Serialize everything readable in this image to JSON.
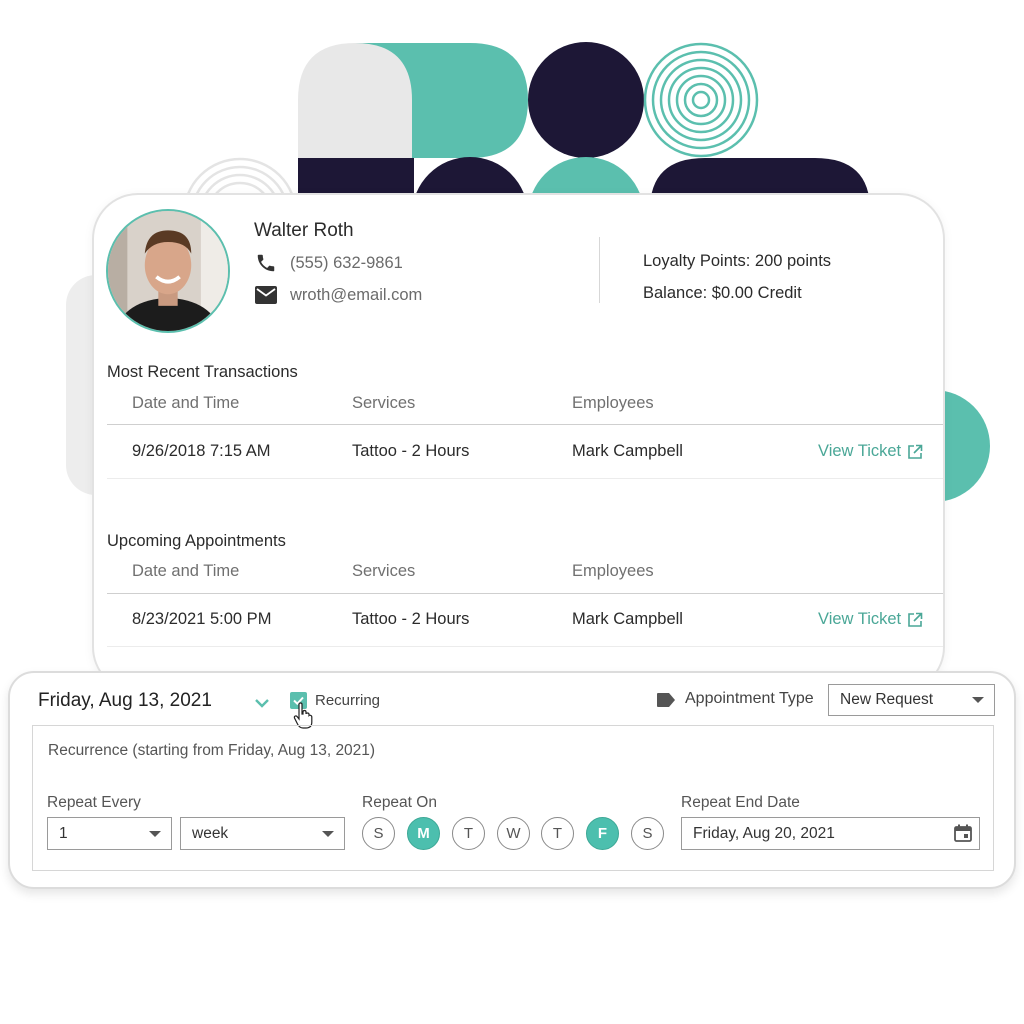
{
  "colors": {
    "accent": "#5bbfae",
    "navy": "#1d1736",
    "light_gray": "#e8e8e8",
    "link": "#4aa797"
  },
  "customer": {
    "name": "Walter Roth",
    "phone": "(555) 632-9861",
    "email": "wroth@email.com",
    "loyalty": "Loyalty Points: 200 points",
    "balance": "Balance: $0.00 Credit",
    "avatar_icon": "customer-photo",
    "phone_icon": "phone-icon",
    "email_icon": "envelope-icon"
  },
  "transactions": {
    "title": "Most Recent Transactions",
    "columns": [
      "Date and Time",
      "Services",
      "Employees"
    ],
    "rows": [
      {
        "datetime": "9/26/2018 7:15 AM",
        "service": "Tattoo - 2 Hours",
        "employee": "Mark Campbell",
        "action": "View Ticket"
      }
    ]
  },
  "appointments": {
    "title": "Upcoming Appointments",
    "columns": [
      "Date and Time",
      "Services",
      "Employees"
    ],
    "rows": [
      {
        "datetime": "8/23/2021 5:00 PM",
        "service": "Tattoo - 2 Hours",
        "employee": "Mark Campbell",
        "action": "View Ticket"
      }
    ]
  },
  "recurrence_panel": {
    "date": "Friday, Aug 13, 2021",
    "recurring_label": "Recurring",
    "recurring_checked": true,
    "appointment_type_label": "Appointment Type",
    "appointment_type_value": "New Request",
    "recurrence_text": "Recurrence (starting from Friday, Aug 13, 2021)",
    "repeat_every_label": "Repeat Every",
    "repeat_every_value": "1",
    "repeat_unit_value": "week",
    "repeat_on_label": "Repeat On",
    "days": [
      {
        "label": "S",
        "selected": false
      },
      {
        "label": "M",
        "selected": true
      },
      {
        "label": "T",
        "selected": false
      },
      {
        "label": "W",
        "selected": false
      },
      {
        "label": "T",
        "selected": false
      },
      {
        "label": "F",
        "selected": true
      },
      {
        "label": "S",
        "selected": false
      }
    ],
    "end_date_label": "Repeat End Date",
    "end_date_value": "Friday, Aug 20, 2021"
  }
}
